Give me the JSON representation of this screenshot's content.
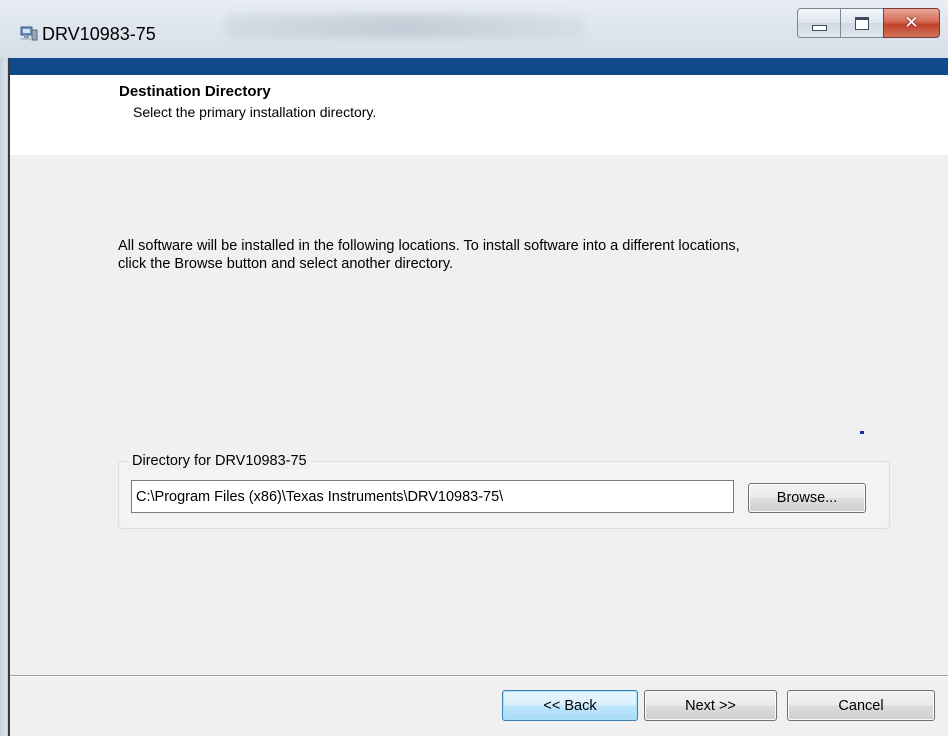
{
  "window": {
    "title": "DRV10983-75",
    "controls": {
      "minimize": "minimize",
      "maximize": "maximize",
      "close": "close"
    }
  },
  "header": {
    "title": "Destination Directory",
    "subtitle": "Select the primary installation directory."
  },
  "body": {
    "description": "All software will be installed in the following locations. To install software into a different locations, click the Browse button and select another directory.",
    "directory_group": {
      "label": "Directory for DRV10983-75",
      "path_value": "C:\\Program Files (x86)\\Texas Instruments\\DRV10983-75\\",
      "browse_label": "Browse..."
    }
  },
  "footer": {
    "back_label": "<< Back",
    "next_label": "Next >>",
    "cancel_label": "Cancel"
  },
  "colors": {
    "accent_bar": "#0f4a8a",
    "dialog_bg": "#f0f0f0",
    "focus_border": "#3c7fb1"
  }
}
